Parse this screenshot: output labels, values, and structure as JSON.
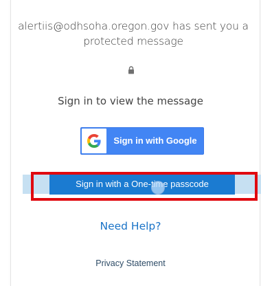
{
  "message": {
    "sender_text": "alertiis@odhsoha.oregon.gov has sent you a protected message",
    "lock_icon": "lock-icon"
  },
  "signin": {
    "prompt": "Sign in to view the message",
    "google_label": "Sign in with Google",
    "google_icon": "google-g-icon",
    "otp_label": "Sign in with a One-time passcode"
  },
  "footer": {
    "help_label": "Need Help?",
    "privacy_label": "Privacy Statement"
  },
  "colors": {
    "google_blue": "#4285f4",
    "otp_blue": "#1b7bd1",
    "highlight_red": "#e0090f",
    "link_blue": "#1a73c7"
  }
}
